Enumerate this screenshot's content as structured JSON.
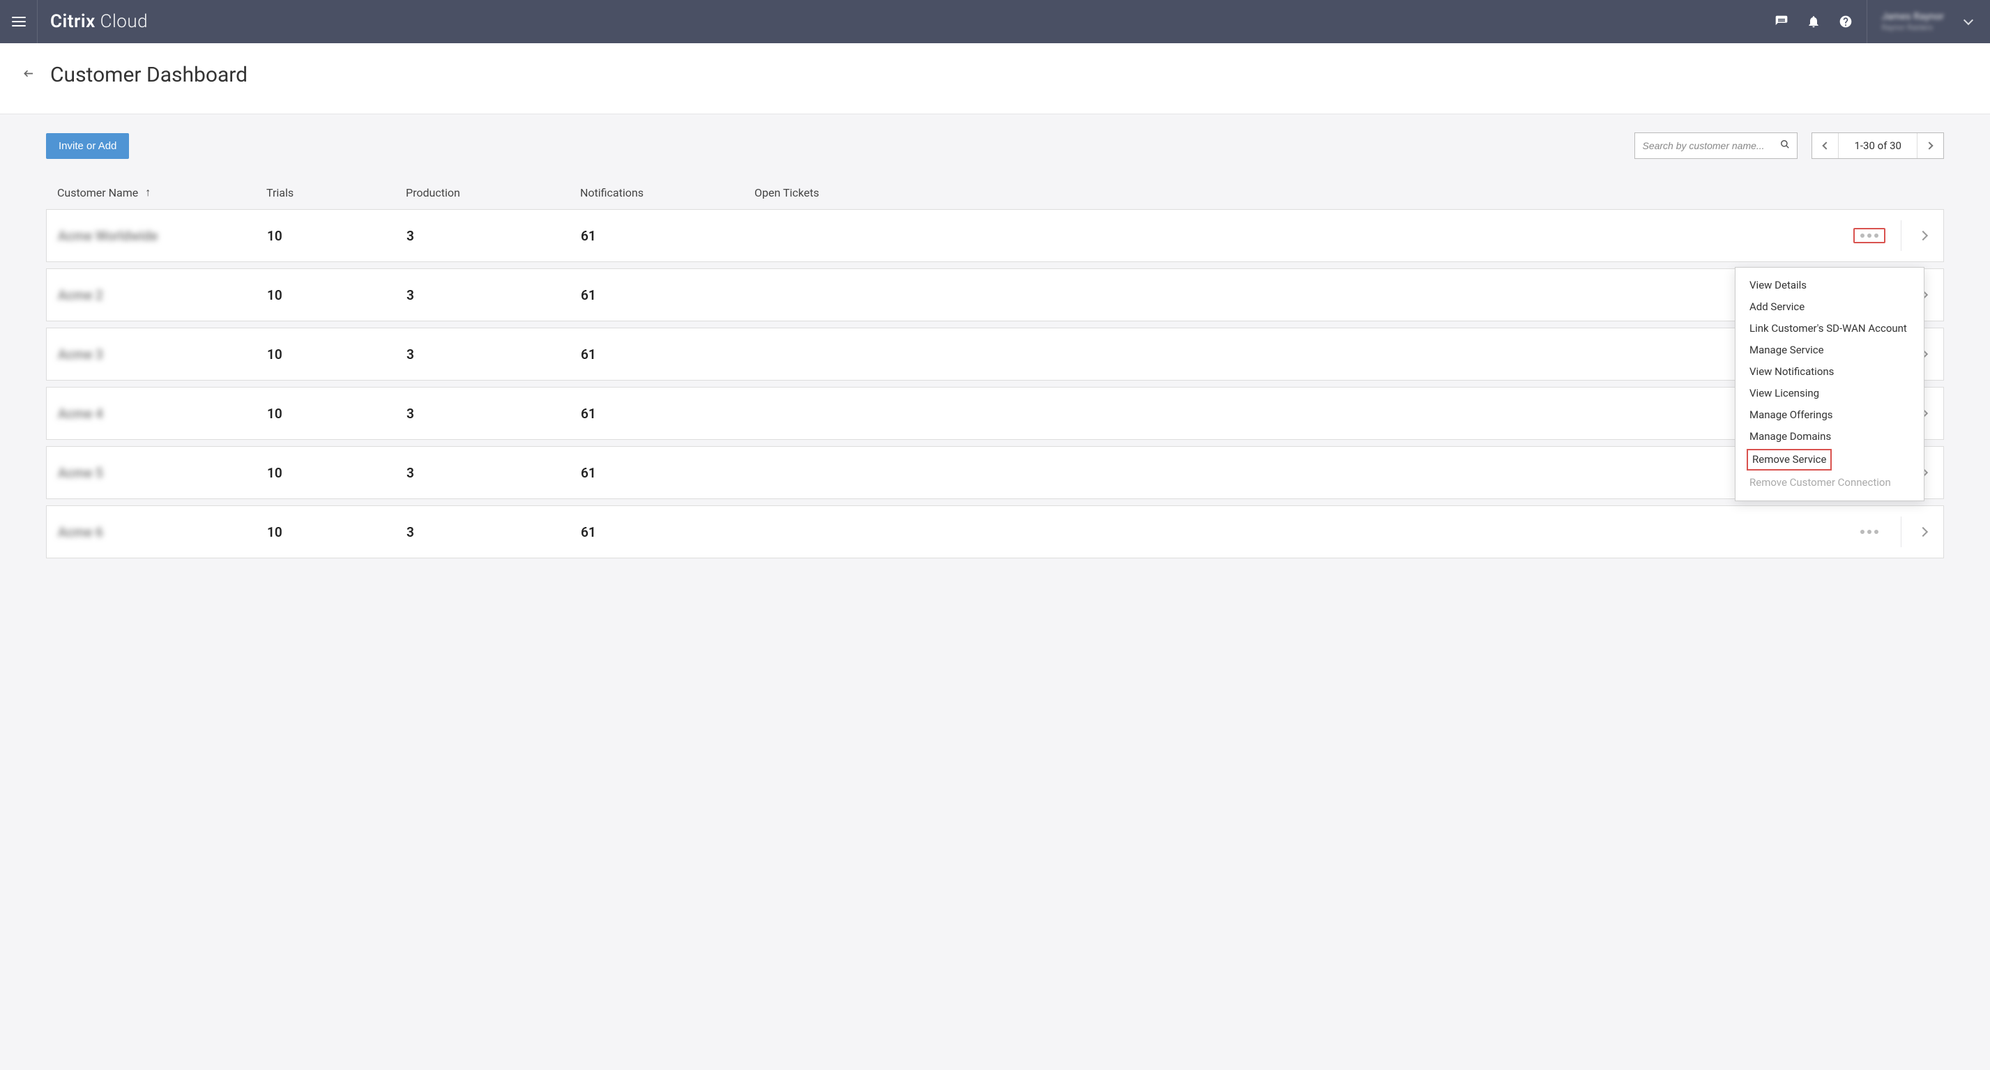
{
  "brand": {
    "bold": "Citrix",
    "light": " Cloud"
  },
  "user": {
    "name": "James Raynor",
    "org": "Raynor Raiders"
  },
  "page": {
    "title": "Customer Dashboard"
  },
  "toolbar": {
    "invite_label": "Invite or Add",
    "search_placeholder": "Search by customer name...",
    "pager_label": "1-30 of 30"
  },
  "columns": {
    "c0": "Customer Name",
    "c1": "Trials",
    "c2": "Production",
    "c3": "Notifications",
    "c4": "Open Tickets",
    "sort_icon": "↑"
  },
  "rows": [
    {
      "name": "Acme Worldwide",
      "trials": "10",
      "production": "3",
      "notifications": "61",
      "open": "",
      "highlight": true
    },
    {
      "name": "Acme 2",
      "trials": "10",
      "production": "3",
      "notifications": "61",
      "open": ""
    },
    {
      "name": "Acme 3",
      "trials": "10",
      "production": "3",
      "notifications": "61",
      "open": ""
    },
    {
      "name": "Acme 4",
      "trials": "10",
      "production": "3",
      "notifications": "61",
      "open": ""
    },
    {
      "name": "Acme 5",
      "trials": "10",
      "production": "3",
      "notifications": "61",
      "open": ""
    },
    {
      "name": "Acme 6",
      "trials": "10",
      "production": "3",
      "notifications": "61",
      "open": ""
    }
  ],
  "menu": {
    "m0": "View Details",
    "m1": "Add Service",
    "m2": "Link Customer's SD-WAN Account",
    "m3": "Manage Service",
    "m4": "View Notifications",
    "m5": "View Licensing",
    "m6": "Manage Offerings",
    "m7": "Manage Domains",
    "m8": "Remove Service",
    "m9": "Remove Customer Connection"
  }
}
